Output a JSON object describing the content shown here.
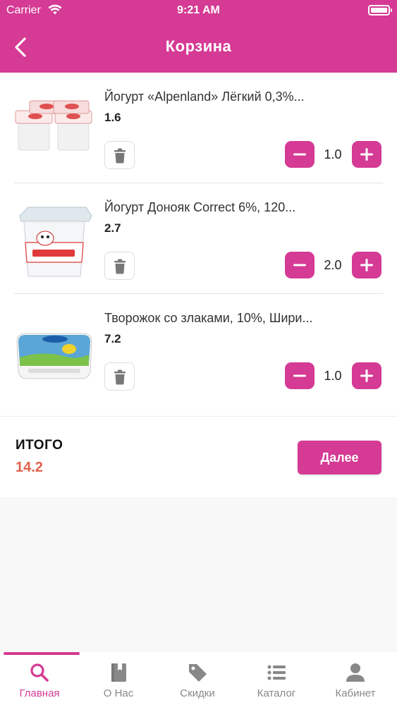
{
  "status_bar": {
    "carrier": "Carrier",
    "time": "9:21 AM"
  },
  "header": {
    "title": "Корзина"
  },
  "cart": {
    "items": [
      {
        "name": "Йогурт «Alpenland» Лёгкий 0,3%...",
        "price": "1.6",
        "quantity": "1.0"
      },
      {
        "name": "Йогурт Донояк Correct 6%, 120...",
        "price": "2.7",
        "quantity": "2.0"
      },
      {
        "name": "Творожок со злаками, 10%, Шири...",
        "price": "7.2",
        "quantity": "1.0"
      }
    ]
  },
  "summary": {
    "total_label": "ИТОГО",
    "total_value": "14.2",
    "next_label": "Далее"
  },
  "tabbar": {
    "tabs": [
      {
        "label": "Главная",
        "icon": "search-icon",
        "active": true
      },
      {
        "label": "О Нас",
        "icon": "book-icon"
      },
      {
        "label": "Скидки",
        "icon": "tag-icon"
      },
      {
        "label": "Каталог",
        "icon": "list-icon"
      },
      {
        "label": "Кабинет",
        "icon": "user-icon"
      }
    ]
  },
  "colors": {
    "accent": "#d53a94",
    "total": "#e0624a",
    "background": "#f8f8f9"
  }
}
